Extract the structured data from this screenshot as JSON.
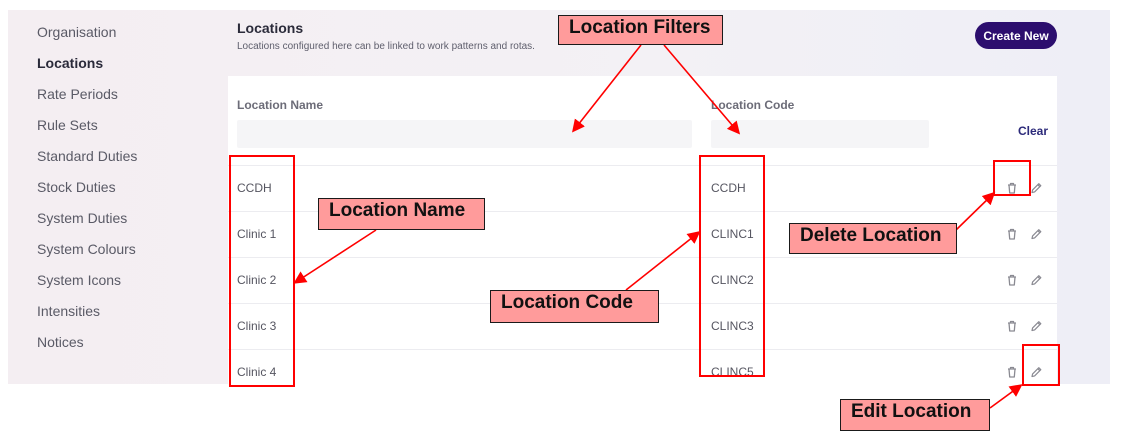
{
  "sidebar": {
    "items": [
      {
        "label": "Organisation",
        "active": false
      },
      {
        "label": "Locations",
        "active": true
      },
      {
        "label": "Rate Periods",
        "active": false
      },
      {
        "label": "Rule Sets",
        "active": false
      },
      {
        "label": "Standard Duties",
        "active": false
      },
      {
        "label": "Stock Duties",
        "active": false
      },
      {
        "label": "System Duties",
        "active": false
      },
      {
        "label": "System Colours",
        "active": false
      },
      {
        "label": "System Icons",
        "active": false
      },
      {
        "label": "Intensities",
        "active": false
      },
      {
        "label": "Notices",
        "active": false
      }
    ]
  },
  "header": {
    "title": "Locations",
    "subtitle": "Locations configured here can be linked to work patterns and rotas.",
    "create_label": "Create New"
  },
  "table": {
    "columns": {
      "name": "Location Name",
      "code": "Location Code"
    },
    "filters": {
      "name_value": "",
      "code_value": ""
    },
    "clear_label": "Clear",
    "rows": [
      {
        "name": "CCDH",
        "code": "CCDH"
      },
      {
        "name": "Clinic 1",
        "code": "CLINC1"
      },
      {
        "name": "Clinic 2",
        "code": "CLINC2"
      },
      {
        "name": "Clinic 3",
        "code": "CLINC3"
      },
      {
        "name": "Clinic 4",
        "code": "CLINC5"
      }
    ],
    "delete_icon": "trash-icon",
    "edit_icon": "pencil-icon"
  },
  "annotations": {
    "location_filters": "Location Filters",
    "location_name": "Location Name",
    "location_code": "Location Code",
    "delete_location": "Delete Location",
    "edit_location": "Edit Location"
  },
  "colors": {
    "accent": "#2c0e6e",
    "annotation_red": "#ff0000",
    "annotation_fill": "#ff9b9b"
  }
}
